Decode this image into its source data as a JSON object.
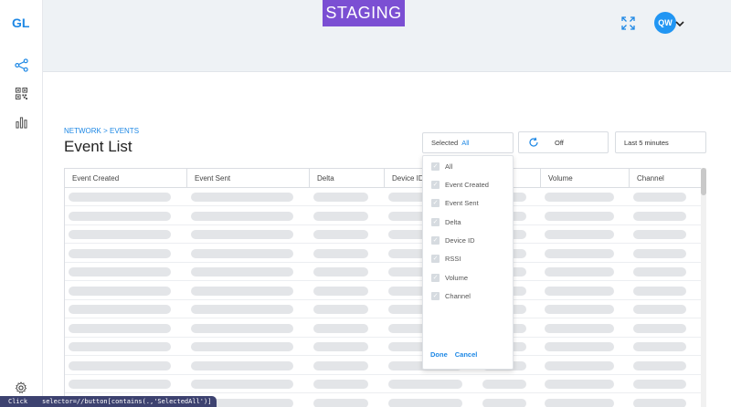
{
  "app": {
    "logo": "GL",
    "environment": "STAGING",
    "user_initials": "QW"
  },
  "sidebar": {
    "items": [
      {
        "name": "network",
        "icon": "share-nodes-icon"
      },
      {
        "name": "qr",
        "icon": "qr-code-icon"
      },
      {
        "name": "analytics",
        "icon": "bar-chart-icon"
      }
    ],
    "settings_icon": "gear-icon"
  },
  "breadcrumb": {
    "root": "NETWORK",
    "separator": " > ",
    "current": "EVENTS"
  },
  "page": {
    "title": "Event List"
  },
  "filters": {
    "select_label": "Selected",
    "select_value": "All",
    "refresh_value": "Off",
    "time_range": "Last 5 minutes"
  },
  "table": {
    "columns": [
      "Event Created",
      "Event Sent",
      "Delta",
      "Device ID",
      "RSSI",
      "Volume",
      "Channel"
    ],
    "row_count": 12,
    "loading": true
  },
  "dropdown": {
    "options": [
      {
        "label": "All",
        "checked": true
      },
      {
        "label": "Event Created",
        "checked": true
      },
      {
        "label": "Event Sent",
        "checked": true
      },
      {
        "label": "Delta",
        "checked": true
      },
      {
        "label": "Device ID",
        "checked": true
      },
      {
        "label": "RSSI",
        "checked": true
      },
      {
        "label": "Volume",
        "checked": true
      },
      {
        "label": "Channel",
        "checked": true
      }
    ],
    "done_label": "Done",
    "cancel_label": "Cancel"
  },
  "status_bar": {
    "action": "Click",
    "selector": "selector=//button[contains(.,'SelectedAll')]"
  },
  "colors": {
    "accent": "#1e88e5",
    "staging_badge": "#7b4fd3",
    "header_bg": "#eef2f5",
    "skeleton": "#e3e5e8",
    "status_bar": "#3d4270"
  }
}
